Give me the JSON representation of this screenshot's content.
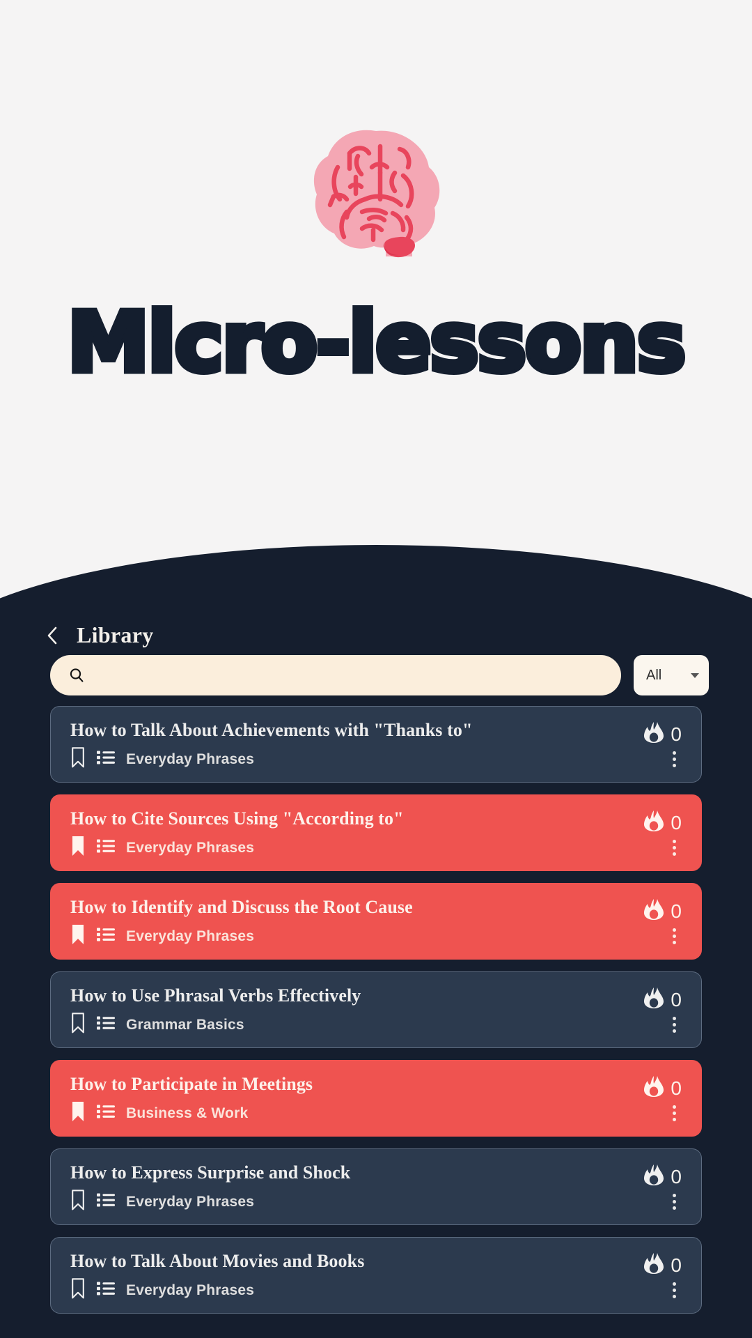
{
  "hero": {
    "title": "Micro-lessons",
    "logo_icon": "brain-icon"
  },
  "header": {
    "back_icon": "chevron-left-icon",
    "title": "Library"
  },
  "search": {
    "icon": "search-icon",
    "value": "",
    "placeholder": "",
    "filter": {
      "selected": "All",
      "caret_icon": "chevron-down-icon"
    }
  },
  "colors": {
    "page_background": "#F5F4F4",
    "dark_section": "#151E2E",
    "card_dark": "#2C3A4E",
    "card_accent_red": "#EF5350",
    "search_cream": "#FBEEDC",
    "title_navy": "#141E2E",
    "brain_pink": "#F4A7B4",
    "brain_red": "#E8455C"
  },
  "lessons": [
    {
      "title": "How to Talk About Achievements with \"Thanks to\"",
      "category": "Everyday Phrases",
      "streak": "0",
      "highlighted": false,
      "bookmarked": false,
      "streak_icon": "flame-icon",
      "bookmark_icon": "bookmark-icon",
      "list_icon": "list-icon",
      "menu_icon": "kebab-menu-icon"
    },
    {
      "title": "How to Cite Sources Using \"According to\"",
      "category": "Everyday Phrases",
      "streak": "0",
      "highlighted": true,
      "bookmarked": true,
      "streak_icon": "flame-icon",
      "bookmark_icon": "bookmark-filled-icon",
      "list_icon": "list-icon",
      "menu_icon": "kebab-menu-icon"
    },
    {
      "title": "How to Identify and Discuss the Root Cause",
      "category": "Everyday Phrases",
      "streak": "0",
      "highlighted": true,
      "bookmarked": true,
      "streak_icon": "flame-icon",
      "bookmark_icon": "bookmark-filled-icon",
      "list_icon": "list-icon",
      "menu_icon": "kebab-menu-icon"
    },
    {
      "title": "How to Use Phrasal Verbs Effectively",
      "category": "Grammar Basics",
      "streak": "0",
      "highlighted": false,
      "bookmarked": false,
      "streak_icon": "flame-icon",
      "bookmark_icon": "bookmark-icon",
      "list_icon": "list-icon",
      "menu_icon": "kebab-menu-icon"
    },
    {
      "title": "How to Participate in Meetings",
      "category": "Business & Work",
      "streak": "0",
      "highlighted": true,
      "bookmarked": true,
      "streak_icon": "flame-icon",
      "bookmark_icon": "bookmark-filled-icon",
      "list_icon": "list-icon",
      "menu_icon": "kebab-menu-icon"
    },
    {
      "title": "How to Express Surprise and Shock",
      "category": "Everyday Phrases",
      "streak": "0",
      "highlighted": false,
      "bookmarked": false,
      "streak_icon": "flame-icon",
      "bookmark_icon": "bookmark-icon",
      "list_icon": "list-icon",
      "menu_icon": "kebab-menu-icon"
    },
    {
      "title": "How to Talk About Movies and Books",
      "category": "Everyday Phrases",
      "streak": "0",
      "highlighted": false,
      "bookmarked": false,
      "streak_icon": "flame-icon",
      "bookmark_icon": "bookmark-icon",
      "list_icon": "list-icon",
      "menu_icon": "kebab-menu-icon"
    }
  ]
}
